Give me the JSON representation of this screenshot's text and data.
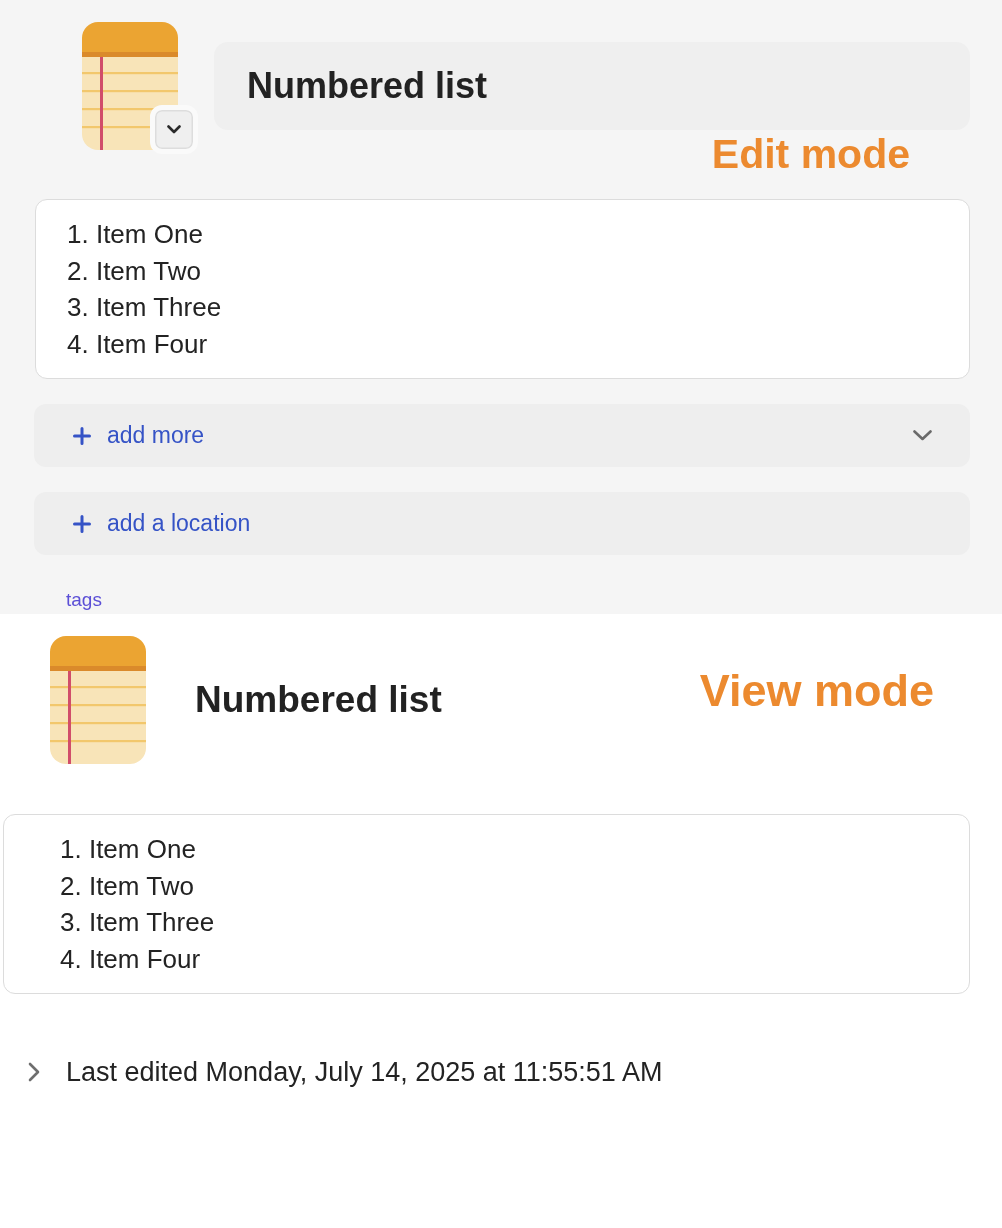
{
  "edit_mode": {
    "annotation": "Edit mode",
    "title": "Numbered list",
    "body_lines": [
      "1. Item One",
      "2. Item Two",
      "3. Item Three",
      "4. Item Four"
    ],
    "actions": [
      {
        "kind": "expandable",
        "label": "add more"
      },
      {
        "kind": "plain",
        "label": "add a location"
      }
    ],
    "tags_label": "tags"
  },
  "view_mode": {
    "annotation": "View mode",
    "title": "Numbered list",
    "body_lines": [
      "1. Item One",
      "2. Item Two",
      "3. Item Three",
      "4. Item Four"
    ],
    "last_edited": {
      "text": "Last edited Monday, July 14, 2025 at 11:55:51 AM",
      "expanded": false
    }
  }
}
